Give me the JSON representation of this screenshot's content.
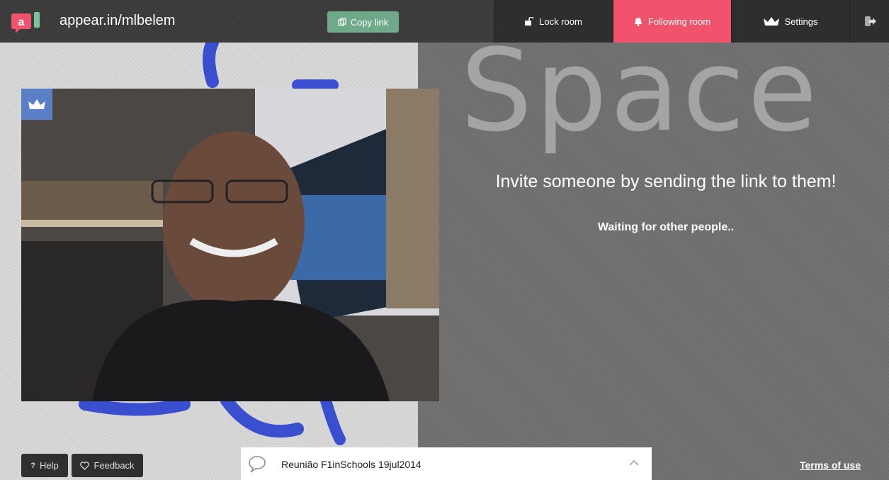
{
  "header": {
    "room_name": "appear.in/mlbelem",
    "copy_link_label": "Copy link"
  },
  "nav": {
    "lock_label": "Lock room",
    "following_label": "Following room",
    "settings_label": "Settings"
  },
  "main": {
    "invite_title": "Invite someone by sending the link to them!",
    "waiting_text": "Waiting for other people..",
    "background_word": "Space"
  },
  "footer": {
    "help_label": "Help",
    "feedback_label": "Feedback",
    "chat_room_title": "Reunião F1inSchools 19jul2014",
    "terms_label": "Terms of use"
  },
  "colors": {
    "accent_following": "#f0536b",
    "copy_button": "#6fa98a",
    "owner_badge": "#5b7fc6",
    "logo_red": "#f0536b",
    "logo_green": "#7bc49c"
  },
  "icons": [
    "appear-in-logo-icon",
    "copy-icon",
    "lock-icon",
    "bell-icon",
    "crown-icon",
    "exit-icon",
    "question-icon",
    "heart-icon",
    "chat-bubble-icon",
    "chevron-up-icon"
  ]
}
